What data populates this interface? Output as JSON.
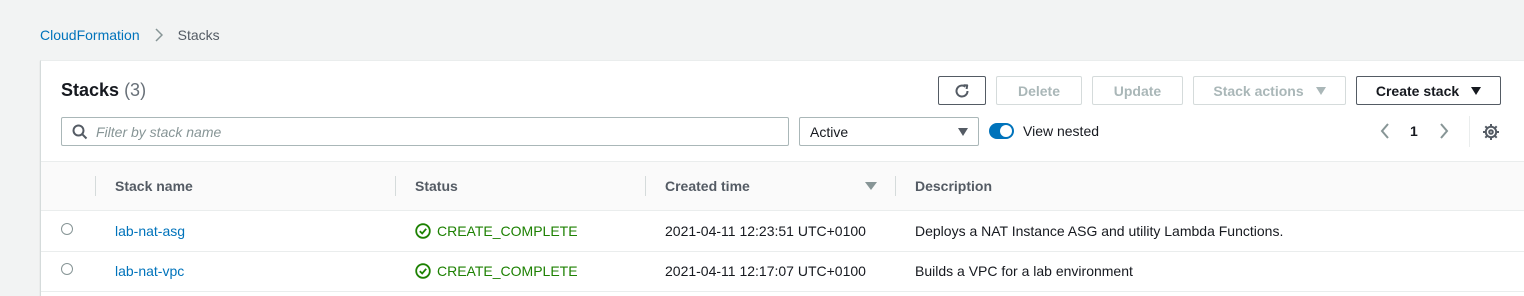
{
  "breadcrumb": {
    "root": "CloudFormation",
    "current": "Stacks"
  },
  "panel": {
    "title": "Stacks",
    "count": "(3)"
  },
  "toolbar": {
    "delete_label": "Delete",
    "update_label": "Update",
    "stack_actions_label": "Stack actions",
    "create_stack_label": "Create stack"
  },
  "filter": {
    "placeholder": "Filter by stack name",
    "status_selected": "Active",
    "view_nested_label": "View nested",
    "view_nested_on": true
  },
  "pagination": {
    "current_page": "1"
  },
  "table": {
    "columns": {
      "name": "Stack name",
      "status": "Status",
      "created": "Created time",
      "description": "Description"
    },
    "rows": [
      {
        "name": "lab-nat-asg",
        "status": "CREATE_COMPLETE",
        "created": "2021-04-11 12:23:51 UTC+0100",
        "description": "Deploys a NAT Instance ASG and utility Lambda Functions."
      },
      {
        "name": "lab-nat-vpc",
        "status": "CREATE_COMPLETE",
        "created": "2021-04-11 12:17:07 UTC+0100",
        "description": "Builds a VPC for a lab environment"
      }
    ]
  },
  "colors": {
    "link": "#0073bb",
    "status_success": "#1d8102",
    "toggle_on": "#0073bb"
  }
}
